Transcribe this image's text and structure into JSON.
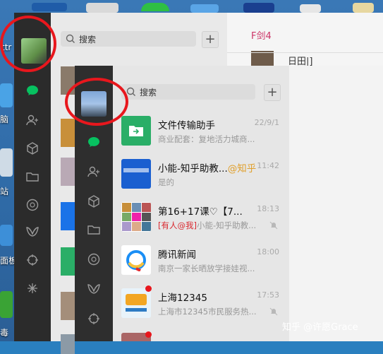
{
  "desktop": {
    "labels": [
      "ttr",
      "脑",
      "站",
      "面板",
      "毒"
    ]
  },
  "back_window": {
    "search_placeholder": "搜索",
    "plus_label": "+",
    "chat_header": "日田|]",
    "chat_badge": "F剑4"
  },
  "front_window": {
    "search_placeholder": "搜索",
    "plus_label": "+",
    "chats": [
      {
        "name": "文件传输助手",
        "time": "22/9/1",
        "preview": "商业配套：复地活力城商...",
        "muted": false,
        "avatar_color": "#2aae67"
      },
      {
        "name": "小能-知乎助教...",
        "name_tag": "@知乎",
        "time": "11:42",
        "preview": "是的",
        "muted": false,
        "avatar_color": "#1a73e8"
      },
      {
        "name": "第16+17课♡【7...",
        "time": "18:13",
        "preview_mention": "[有人@我]",
        "preview": "小能-知乎助教...",
        "muted": true,
        "avatar_color": "#c8a27a"
      },
      {
        "name": "腾讯新闻",
        "time": "18:00",
        "preview": "南京一家长晒放学接娃视...",
        "muted": false,
        "avatar_color": "#ffffff"
      },
      {
        "name": "上海12345",
        "time": "17:53",
        "preview": "上海市12345市民服务热...",
        "muted": true,
        "avatar_color": "#d9ecf7",
        "badge_color": "#e8171d"
      }
    ]
  },
  "watermark": "知乎 @许愿Grace",
  "colors": {
    "sidebar_dark": "#2e2e2e",
    "list_bg": "#e6e6e6",
    "wechat_green": "#07c160",
    "highlight_red": "#e8171d",
    "mention_red": "#d9272e",
    "zhihu_tag": "#e09f2a"
  }
}
